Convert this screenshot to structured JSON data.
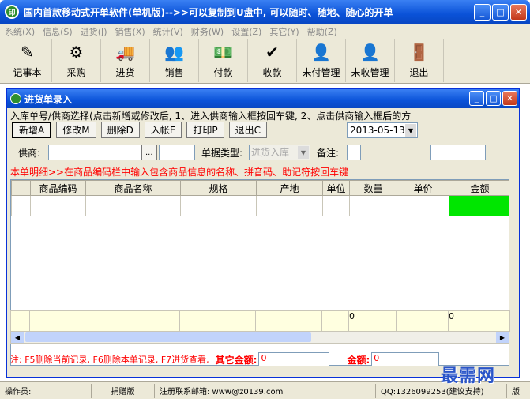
{
  "app": {
    "title": "国内首款移动式开单软件(单机版)-->>可以复制到U盘中, 可以随时、随地、随心的开单",
    "icon_text": "印"
  },
  "menu": [
    "系统(X)",
    "信息(S)",
    "进货(J)",
    "销售(X)",
    "统计(V)",
    "财务(W)",
    "设置(Z)",
    "其它(Y)",
    "帮助(Z)"
  ],
  "toolbar": [
    {
      "label": "记事本",
      "icon": "notebook-icon",
      "glyph": "✎"
    },
    {
      "label": "采购",
      "icon": "purchase-icon",
      "glyph": "⚙"
    },
    {
      "label": "进货",
      "icon": "truck-icon",
      "glyph": "🚚"
    },
    {
      "label": "销售",
      "icon": "sales-icon",
      "glyph": "👥"
    },
    {
      "label": "付款",
      "icon": "payment-icon",
      "glyph": "💵"
    },
    {
      "label": "收款",
      "icon": "checkmark-icon",
      "glyph": "✔"
    },
    {
      "label": "未付管理",
      "icon": "unpaid-icon",
      "glyph": "👤"
    },
    {
      "label": "未收管理",
      "icon": "unreceived-icon",
      "glyph": "👤"
    },
    {
      "label": "退出",
      "icon": "exit-icon",
      "glyph": "🚪"
    }
  ],
  "subwindow": {
    "title": "进货单录入",
    "hint": "入库单号/供商选择(点击新增或修改后, 1、进入供商输入框按回车键, 2、点击供商输入框后的方",
    "actions": [
      "新增A",
      "修改M",
      "删除D",
      "入帐E",
      "打印P",
      "退出C"
    ],
    "date": "2013-05-13",
    "supplier_label": "供商:",
    "supplier_btn": "...",
    "doctype_label": "单据类型:",
    "doctype_value": "进货入库",
    "note_label": "备注:",
    "detail_hint": "本单明细>>在商品编码栏中输入包含商品信息的名称、拼音码、助记符按回车键",
    "columns": [
      "商品编码",
      "商品名称",
      "规格",
      "产地",
      "单位",
      "数量",
      "单价",
      "金额"
    ],
    "sum_qty": "0",
    "sum_amount": "0",
    "footnote": "注: F5删除当前记录, F6删除本单记录, F7进货查看,",
    "other_amount_label": "其它金额:",
    "other_amount_value": "0",
    "amount_label": "金额:",
    "amount_value": "0"
  },
  "status": {
    "operator": "操作员:",
    "edition": "捐赠版",
    "email": "注册联系邮箱: www@z0139.com",
    "qq": "QQ:1326099253(建议支持)",
    "version": "版"
  },
  "watermark": "最需网",
  "colors": {
    "accent": "#0a52d8",
    "green_cell": "#00e600",
    "hint_red": "#ff0000"
  }
}
